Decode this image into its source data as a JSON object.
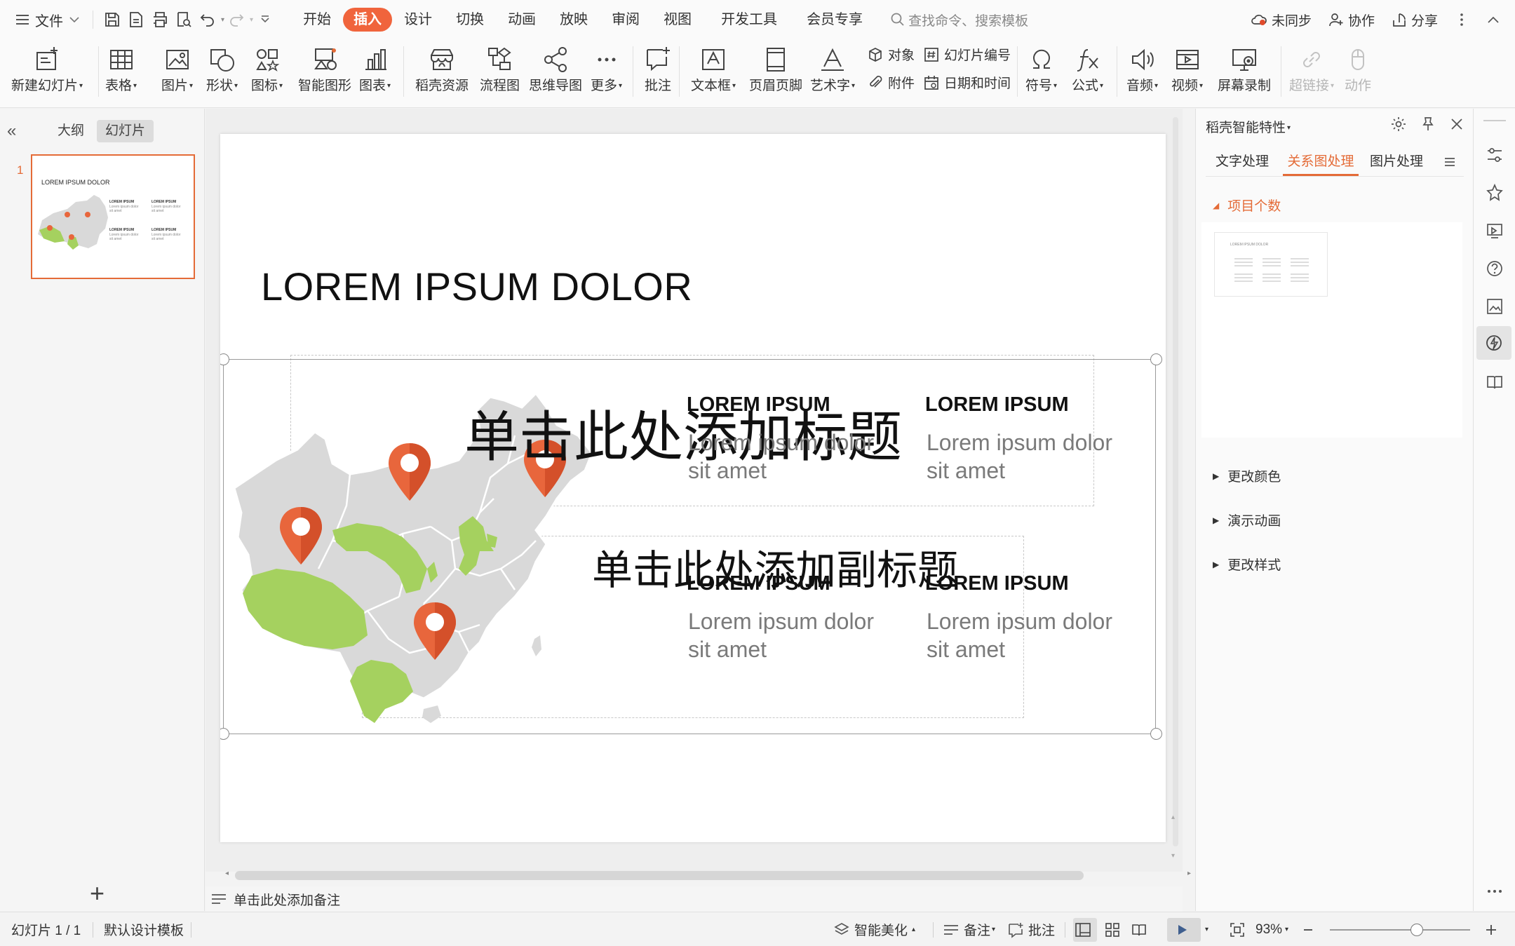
{
  "menubar": {
    "file": "文件",
    "tabs": [
      {
        "label": "开始",
        "active": false
      },
      {
        "label": "插入",
        "active": true
      },
      {
        "label": "设计",
        "active": false
      },
      {
        "label": "切换",
        "active": false
      },
      {
        "label": "动画",
        "active": false
      },
      {
        "label": "放映",
        "active": false
      },
      {
        "label": "审阅",
        "active": false
      },
      {
        "label": "视图",
        "active": false
      },
      {
        "label": "开发工具",
        "active": false
      },
      {
        "label": "会员专享",
        "active": false
      }
    ],
    "search_placeholder": "查找命令、搜索模板",
    "sync": "未同步",
    "collab": "协作",
    "share": "分享"
  },
  "ribbon": {
    "new_slide": "新建幻灯片",
    "table": "表格",
    "picture": "图片",
    "shape": "形状",
    "icon": "图标",
    "smartart": "智能图形",
    "chart": "图表",
    "daoke": "稻壳资源",
    "flowchart": "流程图",
    "mindmap": "思维导图",
    "more": "更多",
    "comment": "批注",
    "textbox": "文本框",
    "header_footer": "页眉页脚",
    "wordart": "艺术字",
    "object": "对象",
    "slide_number": "幻灯片编号",
    "attachment": "附件",
    "date_time": "日期和时间",
    "symbol": "符号",
    "formula": "公式",
    "audio": "音频",
    "video": "视频",
    "screen_record": "屏幕录制",
    "hyperlink": "超链接",
    "action": "动作"
  },
  "leftpanel": {
    "tab_outline": "大纲",
    "tab_slides": "幻灯片",
    "slide_number": "1",
    "thumb": {
      "title": "LOREM IPSUM DOLOR",
      "heading": "LOREM IPSUM",
      "body": "Lorem ipsum dolor sit amet"
    }
  },
  "slide": {
    "title": "LOREM IPSUM DOLOR",
    "placeholder_title": "单击此处添加标题",
    "placeholder_subtitle": "单击此处添加副标题",
    "cards": [
      {
        "heading": "LOREM IPSUM",
        "body": "Lorem ipsum dolor sit amet"
      },
      {
        "heading": "LOREM IPSUM",
        "body": "Lorem ipsum dolor sit amet"
      },
      {
        "heading": "LOREM IPSUM",
        "body": "Lorem ipsum dolor sit amet"
      },
      {
        "heading": "LOREM IPSUM",
        "body": "Lorem ipsum dolor sit amet"
      }
    ],
    "colors": {
      "map_gray": "#d9d9d9",
      "map_green": "#a5d15f",
      "pin_orange": "#e8663c"
    }
  },
  "notes": {
    "placeholder": "单击此处添加备注"
  },
  "rightpane": {
    "title": "稻壳智能特性",
    "tabs": [
      {
        "label": "文字处理",
        "active": false
      },
      {
        "label": "关系图处理",
        "active": true
      },
      {
        "label": "图片处理",
        "active": false
      }
    ],
    "sections": [
      {
        "label": "项目个数",
        "open": true
      },
      {
        "label": "更改颜色",
        "open": false
      },
      {
        "label": "演示动画",
        "open": false
      },
      {
        "label": "更改样式",
        "open": false
      }
    ],
    "preview_title": "LOREM IPSUM DOLOR"
  },
  "statusbar": {
    "slide_counter": "幻灯片 1 / 1",
    "template": "默认设计模板",
    "beautify": "智能美化",
    "notes": "备注",
    "comments": "批注",
    "zoom": "93%",
    "zoom_level": 0.62
  },
  "accent_color": "#e46b37"
}
